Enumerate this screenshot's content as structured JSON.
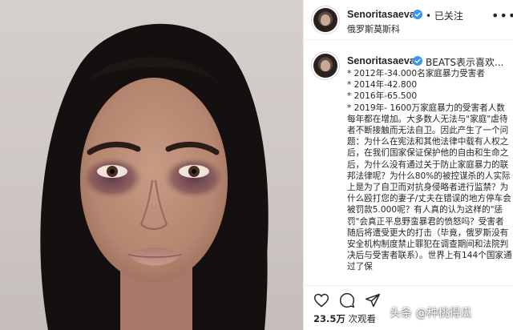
{
  "post": {
    "username": "Senoritasaeva",
    "follow_status": "• 已关注",
    "location": "俄罗斯莫斯科",
    "caption_head": "BEATS表示喜欢...",
    "caption_body": "* 2012年-34.000名家庭暴力受害者\n* 2014年-42.800\n* 2016年-65.500\n* 2019年- 1600万家庭暴力的受害者人数每年都在增加。大多数人无法与\"家庭\"虐待者不断接触而无法自卫。因此产生了一个问题：为什么在宪法和其他法律中载有人权之后，在我们国家保证保护他的自由和生命之后，为什么没有通过关于防止家庭暴力的联邦法律呢？为什么80%的被控谋杀的人实际上是为了自卫而对抗身侵略者进行监禁？为什么殴打您的妻子/丈夫在错误的地方停车会被罚款5.000呢？有人真的认为这样的\"惩罚\"会真正平息野蛮暴君的愤怒吗？受害者随后将遭受更大的打击（毕竟，俄罗斯没有安全机构制度禁止罪犯在调查期间和法院判决后与受害者联系）。世界上有144个国家通过了保",
    "views_count": "23.5万",
    "views_label": "次观看"
  },
  "icons": {
    "verified": "verified-badge-icon",
    "more": "more-options-icon",
    "like": "heart-icon",
    "comment": "comment-bubble-icon",
    "share": "paper-plane-icon"
  },
  "watermark": "头条 @种桃得瓜",
  "colors": {
    "verified_blue": "#3897f0",
    "text": "#262626",
    "border": "#efefef"
  }
}
